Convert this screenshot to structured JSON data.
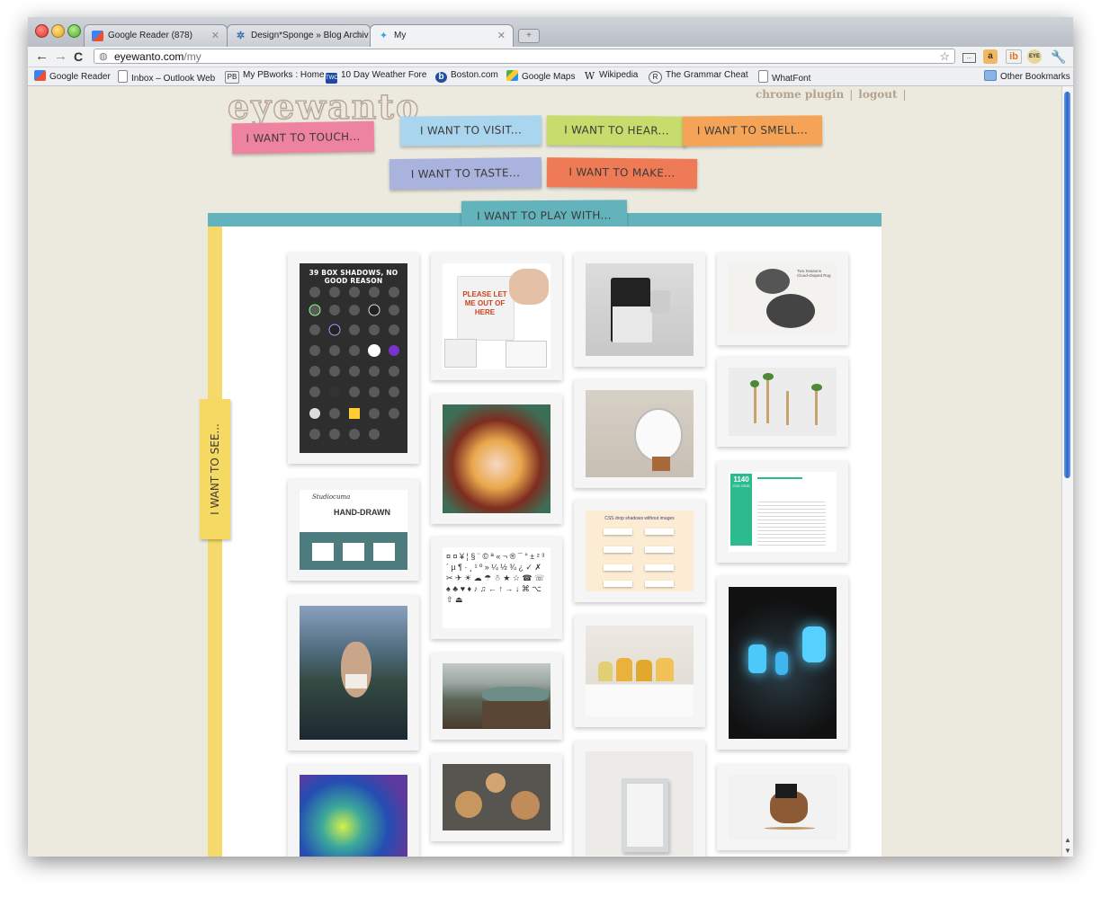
{
  "browser": {
    "tabs": [
      {
        "title": "Google Reader (878)",
        "icon": "google-reader-icon"
      },
      {
        "title": "Design*Sponge » Blog Archiv",
        "icon": "design-sponge-icon"
      },
      {
        "title": "My",
        "icon": "twitter-bird-icon"
      }
    ],
    "url_host": "eyewanto.com",
    "url_path": "/my",
    "bookmarks": [
      {
        "label": "Google Reader",
        "icon": "google-reader-icon"
      },
      {
        "label": "Inbox – Outlook Web",
        "icon": "page-icon"
      },
      {
        "label": "My PBworks : Home",
        "icon": "pbworks-icon",
        "icon_text": "PB"
      },
      {
        "label": "10 Day Weather Fore",
        "icon": "weather-channel-icon",
        "icon_text": "TWC"
      },
      {
        "label": "Boston.com",
        "icon": "boston-icon",
        "icon_text": "b"
      },
      {
        "label": "Google Maps",
        "icon": "google-maps-icon"
      },
      {
        "label": "Wikipedia",
        "icon": "wikipedia-icon",
        "icon_text": "W"
      },
      {
        "label": "The Grammar Cheat",
        "icon": "grammar-icon",
        "icon_text": "R"
      },
      {
        "label": "WhatFont",
        "icon": "page-icon"
      }
    ],
    "other_bookmarks": "Other Bookmarks",
    "extension_icons": [
      "page-icon",
      "amazon-icon",
      "ib-icon",
      "eye-icon",
      "wrench-icon"
    ],
    "ext_labels": {
      "ib": "ib",
      "eye": "EYE"
    }
  },
  "site": {
    "logo": "eyewanto",
    "links": {
      "plugin": "chrome plugin",
      "logout": "logout",
      "sep": "|"
    },
    "categories": {
      "touch": {
        "label": "I WANT TO TOUCH...",
        "color": "#ee83a1"
      },
      "visit": {
        "label": "I WANT TO VISIT...",
        "color": "#a9d6ee"
      },
      "hear": {
        "label": "I WANT TO HEAR...",
        "color": "#c6dc6c"
      },
      "smell": {
        "label": "I WANT TO SMELL...",
        "color": "#f4a357"
      },
      "taste": {
        "label": "I WANT TO TASTE...",
        "color": "#aab3dd"
      },
      "make": {
        "label": "I WANT TO MAKE...",
        "color": "#ef7b56"
      },
      "play": {
        "label": "I WANT TO PLAY WITH...",
        "color": "#62b3bb"
      },
      "see": {
        "label": "I WANT TO SEE...",
        "color": "#f6d963"
      }
    },
    "cards": {
      "shadows_title": "39 BOX SHADOWS, NO GOOD REASON",
      "mug_text": "PLEASE LET ME OUT OF HERE",
      "handdrawn_title": "HAND-DRAWN",
      "handdrawn_brand": "Studiocuma",
      "css_title": "CSS drop shadows without images",
      "grid_title": "1140",
      "grid_sub": "CSS GRID",
      "cloud_title": "Two Seasons Cloud-shaped Rug",
      "glyphs": "¤ ¤ ¥ ¦ § ¨ © ª « ¬ ® ¯ ° ± ² ³ ´ µ ¶ · ¸ ¹ º » ¼ ½ ¾ ¿ ✓ ✗ ✂ ✈ ☀ ☁ ☂ ☃ ★ ☆ ☎ ☏ ♠ ♣ ♥ ♦ ♪ ♫ ← ↑ → ↓ ⌘ ⌥ ⇧ ⏏"
    }
  }
}
